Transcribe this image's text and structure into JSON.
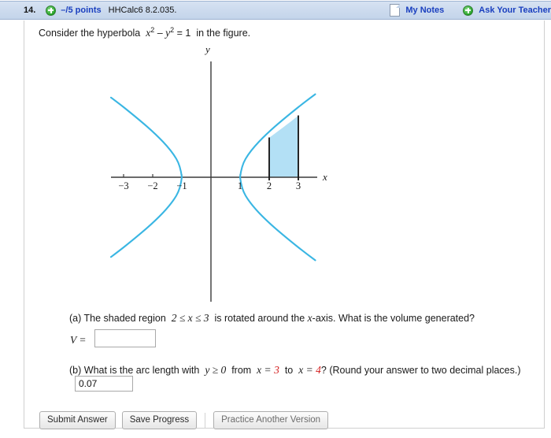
{
  "header": {
    "question_number": "14.",
    "plus_icon": "plus-circle-icon",
    "points": "–/5 points",
    "question_code": "HHCalc6 8.2.035.",
    "notes_icon": "note-page-icon",
    "my_notes": "My Notes",
    "ask_plus_icon": "plus-circle-icon",
    "ask_your_teacher": "Ask Your Teacher"
  },
  "question": {
    "stem_before": "Consider the hyperbola",
    "stem_math_x": "x",
    "stem_exp_2a": "2",
    "stem_minus": "–",
    "stem_math_y": "y",
    "stem_exp_2b": "2",
    "stem_equals": "= 1",
    "stem_after": "in the figure."
  },
  "figure": {
    "x_axis_label": "x",
    "y_axis_label": "y",
    "x_ticks": [
      "−3",
      "−2",
      "−1",
      "1",
      "2",
      "3"
    ],
    "curve_color": "#3ab6e3",
    "shade_color": "#b3e0f5",
    "bound_line_color": "#1a1a1a",
    "axis_color": "#3a3a3a",
    "shaded_from": 2,
    "shaded_to": 3
  },
  "parts": {
    "a": {
      "label": "(a)",
      "text_1": "The shaded region",
      "ineq": "2 ≤ x ≤ 3",
      "text_2": "is rotated around the",
      "axis_word": "x",
      "text_3": "-axis. What is the volume generated?",
      "v_label": "V =",
      "answer_value": "",
      "answer_placeholder": ""
    },
    "b": {
      "label": "(b)",
      "text_1": "What is the arc length with",
      "cond": "y ≥ 0",
      "text_2": "from",
      "x1_label": "x =",
      "x1_value": "3",
      "text_3": "to",
      "x2_label": "x =",
      "x2_value": "4",
      "text_4": "? (Round your answer to two decimal places.)",
      "answer_value": "0.07",
      "answer_placeholder": ""
    }
  },
  "buttons": {
    "submit": "Submit Answer",
    "save": "Save Progress",
    "practice": "Practice Another Version"
  },
  "chart_data": {
    "type": "line",
    "title": "",
    "xlabel": "x",
    "ylabel": "y",
    "xlim": [
      -4.1,
      3.85
    ],
    "ylim": [
      -4.1,
      4.1
    ],
    "grid": false,
    "legend": null,
    "curves": [
      {
        "name": "hyperbola right branch, y>=0",
        "equation": "y = sqrt(x^2 - 1)",
        "x_from": 1,
        "x_to": 3.55
      },
      {
        "name": "hyperbola right branch, y<=0",
        "equation": "y = -sqrt(x^2 - 1)",
        "x_from": 1,
        "x_to": 3.55
      },
      {
        "name": "hyperbola left branch, y>=0",
        "equation": "y = sqrt(x^2 - 1)",
        "x_from": -3.4,
        "x_to": -1
      },
      {
        "name": "hyperbola left branch, y<=0",
        "equation": "y = -sqrt(x^2 - 1)",
        "x_from": -3.4,
        "x_to": -1
      }
    ],
    "shaded_region": {
      "x_from": 2,
      "x_to": 3,
      "upper": "y = sqrt(x^2 - 1)",
      "lower": "y = 0"
    },
    "vertical_lines": [
      2,
      3
    ],
    "xticks": [
      -3,
      -2,
      -1,
      1,
      2,
      3
    ],
    "yticks": []
  }
}
